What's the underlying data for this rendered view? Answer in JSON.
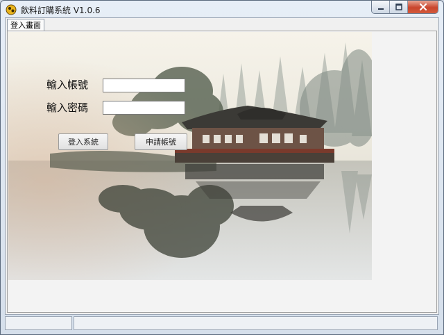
{
  "window": {
    "title": "飲料訂購系統 V1.0.6"
  },
  "tabs": [
    {
      "label": "登入畫面"
    }
  ],
  "login": {
    "account_label": "輸入帳號",
    "password_label": "輸入密碼",
    "account_value": "",
    "password_value": "",
    "login_button": "登入系統",
    "register_button": "申請帳號"
  },
  "statusbar": {
    "panels": [
      "",
      ""
    ]
  },
  "colors": {
    "close_button": "#c8452d",
    "titlebar": "#dbe4ef"
  }
}
